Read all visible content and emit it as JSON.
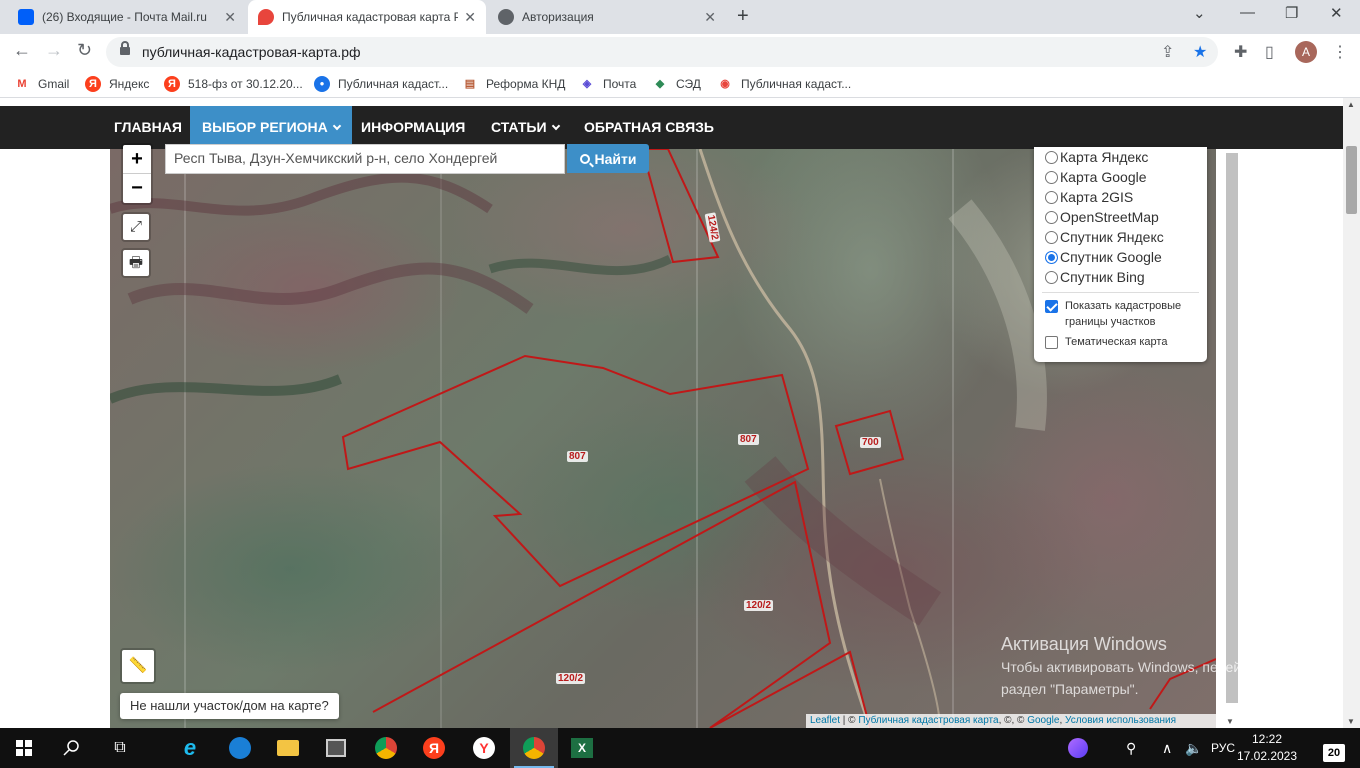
{
  "browser": {
    "tabs": [
      {
        "title": "(26) Входящие - Почта Mail.ru",
        "icon": "mail-icon",
        "color": "#005ff9"
      },
      {
        "title": "Публичная кадастровая карта Р",
        "icon": "map-pin-icon",
        "color": "#e8453c"
      },
      {
        "title": "Авторизация",
        "icon": "globe-icon",
        "color": "#5f6368"
      }
    ],
    "url": "публичная-кадастровая-карта.рф",
    "avatar_letter": "A",
    "bookmarks": [
      {
        "label": "Gmail",
        "icon": "gmail-icon",
        "color": "#ea4335",
        "glyph": "M"
      },
      {
        "label": "Яндекс",
        "icon": "yandex-icon",
        "color": "#fc3f1d",
        "glyph": "Я"
      },
      {
        "label": "518-фз от 30.12.20...",
        "icon": "yandex-icon",
        "color": "#fc3f1d",
        "glyph": "Я"
      },
      {
        "label": "Публичная кадаст...",
        "icon": "globe-icon",
        "color": "#1a73e8",
        "glyph": "●"
      },
      {
        "label": "Реформа КНД",
        "icon": "document-icon",
        "color": "#b85c38",
        "glyph": "▤"
      },
      {
        "label": "Почта",
        "icon": "cube-icon",
        "color": "#5b4dd6",
        "glyph": "◈"
      },
      {
        "label": "СЭД",
        "icon": "sed-icon",
        "color": "#2e8b57",
        "glyph": "◆"
      },
      {
        "label": "Публичная кадаст...",
        "icon": "map-pin-icon",
        "color": "#e8453c",
        "glyph": "◉"
      }
    ]
  },
  "site": {
    "nav": [
      {
        "label": "ГЛАВНАЯ",
        "active": false,
        "dropdown": false
      },
      {
        "label": "ВЫБОР РЕГИОНА",
        "active": true,
        "dropdown": true
      },
      {
        "label": "ИНФОРМАЦИЯ",
        "active": false,
        "dropdown": false
      },
      {
        "label": "СТАТЬИ",
        "active": false,
        "dropdown": true
      },
      {
        "label": "ОБРАТНАЯ СВЯЗЬ",
        "active": false,
        "dropdown": false
      }
    ],
    "search": {
      "value": "Респ Тыва, Дзун-Хемчикский р-н, село Хондергей",
      "button": "Найти"
    },
    "zoom": {
      "plus": "+",
      "minus": "−"
    },
    "layers": [
      {
        "label": "Карта Яндекс",
        "selected": false
      },
      {
        "label": "Карта Google",
        "selected": false
      },
      {
        "label": "Карта 2GIS",
        "selected": false
      },
      {
        "label": "OpenStreetMap",
        "selected": false
      },
      {
        "label": "Спутник Яндекс",
        "selected": false
      },
      {
        "label": "Спутник Google",
        "selected": true
      },
      {
        "label": "Спутник Bing",
        "selected": false
      }
    ],
    "options": [
      {
        "label": "Показать кадастровые границы участков",
        "checked": true
      },
      {
        "label": "Тематическая карта",
        "checked": false
      }
    ],
    "parcels": [
      "124/2",
      "807",
      "807",
      "700",
      "120/2",
      "120/2"
    ],
    "not_found": "Не нашли участок/дом на карте?",
    "attribution": {
      "leaflet": "Leaflet",
      "sep1": " | © ",
      "pkk": "Публичная кадастровая карта",
      "sep2": ", ©, © ",
      "google": "Google",
      "sep3": ", ",
      "terms": "Условия использования"
    },
    "watermark": {
      "title": "Активация Windows",
      "line1": "Чтобы активировать Windows, перейдите в",
      "line2": "раздел \"Параметры\"."
    }
  },
  "taskbar": {
    "language": "РУС",
    "time": "12:22",
    "date": "17.02.2023",
    "notifications": "20"
  }
}
